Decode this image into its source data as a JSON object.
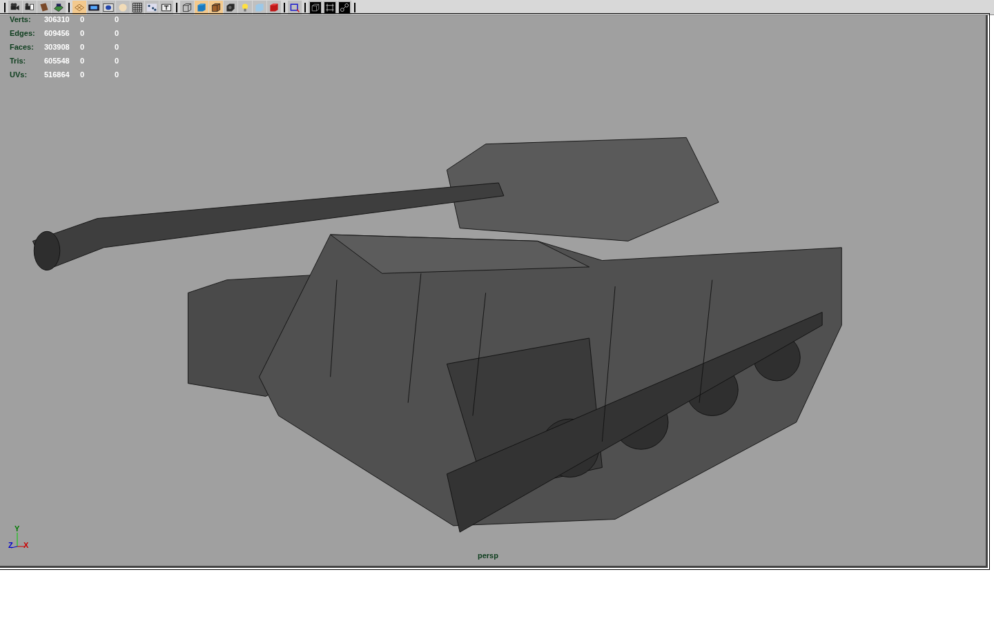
{
  "toolbar": {
    "groups": [
      [
        {
          "kind": "camera",
          "on": false
        },
        {
          "kind": "camera-attributes",
          "on": false
        },
        {
          "kind": "bookmark",
          "on": false
        },
        {
          "kind": "image-plane",
          "on": false
        }
      ],
      [
        {
          "kind": "grid",
          "on": true
        },
        {
          "kind": "film-gate",
          "on": false
        },
        {
          "kind": "sphere",
          "on": false
        },
        {
          "kind": "disc",
          "on": false
        },
        {
          "kind": "mesh",
          "on": false
        },
        {
          "kind": "uv",
          "on": false
        },
        {
          "kind": "text",
          "on": false
        }
      ],
      [
        {
          "kind": "wire-cube",
          "on": false
        },
        {
          "kind": "shaded-cube",
          "on": true
        },
        {
          "kind": "textured-cube",
          "on": true
        },
        {
          "kind": "checker",
          "on": false
        },
        {
          "kind": "bulb",
          "on": false
        },
        {
          "kind": "pale-cube",
          "on": false
        },
        {
          "kind": "red-cube",
          "on": false
        }
      ],
      [
        {
          "kind": "frame",
          "on": false
        }
      ],
      [
        {
          "kind": "isolate",
          "on": false
        },
        {
          "kind": "hull",
          "on": false
        },
        {
          "kind": "joint",
          "on": false
        }
      ]
    ]
  },
  "heads_up": {
    "rows": [
      {
        "label": "Verts:",
        "values": [
          "306310",
          "0",
          "0"
        ]
      },
      {
        "label": "Edges:",
        "values": [
          "609456",
          "0",
          "0"
        ]
      },
      {
        "label": "Faces:",
        "values": [
          "303908",
          "0",
          "0"
        ]
      },
      {
        "label": "Tris:",
        "values": [
          "605548",
          "0",
          "0"
        ]
      },
      {
        "label": "UVs:",
        "values": [
          "516864",
          "0",
          "0"
        ]
      }
    ]
  },
  "axis": {
    "y": "Y",
    "z": "Z",
    "x": "X"
  },
  "camera_name": "persp"
}
